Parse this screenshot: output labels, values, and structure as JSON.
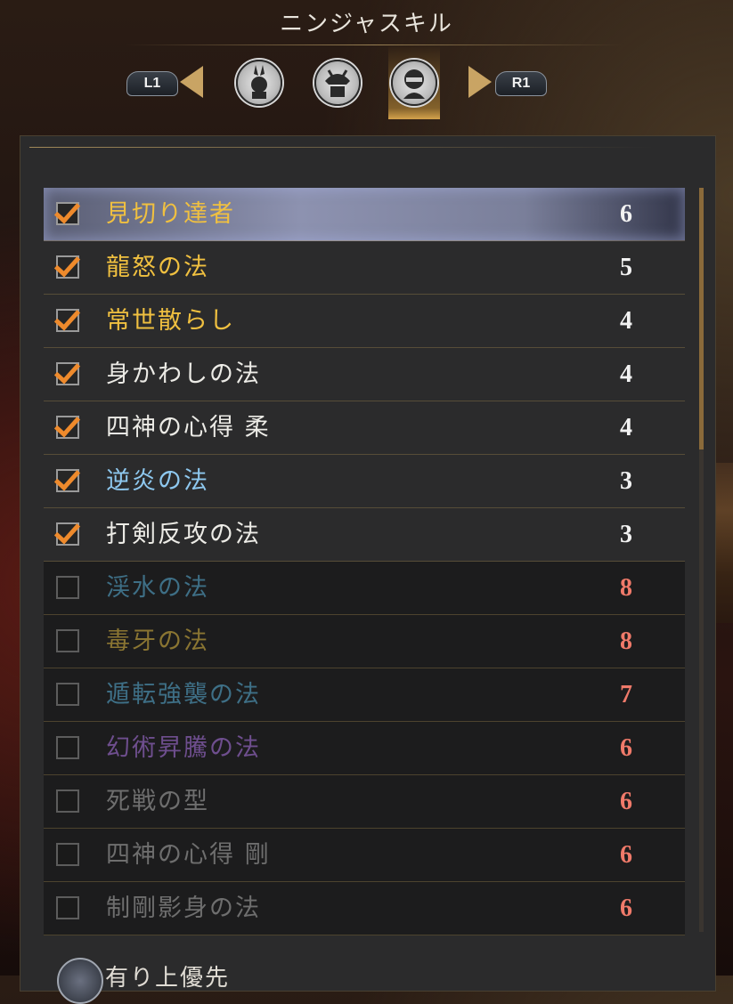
{
  "header": {
    "title": "ニンジャスキル"
  },
  "tabs": {
    "left_button": "L1",
    "right_button": "R1",
    "items": [
      {
        "icon": "ninja-rabbit-icon",
        "active": false
      },
      {
        "icon": "samurai-helmet-icon",
        "active": false
      },
      {
        "icon": "ninja-mask-icon",
        "active": true
      }
    ]
  },
  "skills": [
    {
      "name": "見切り達者",
      "cost": "6",
      "checked": true,
      "name_color": "#f0c040",
      "cost_color": "#f2f2f2",
      "selected": true
    },
    {
      "name": "龍怒の法",
      "cost": "5",
      "checked": true,
      "name_color": "#f0c040",
      "cost_color": "#f2f2f2"
    },
    {
      "name": "常世散らし",
      "cost": "4",
      "checked": true,
      "name_color": "#f0c040",
      "cost_color": "#f2f2f2"
    },
    {
      "name": "身かわしの法",
      "cost": "4",
      "checked": true,
      "name_color": "#ecebe6",
      "cost_color": "#f2f2f2"
    },
    {
      "name": "四神の心得 柔",
      "cost": "4",
      "checked": true,
      "name_color": "#ecebe6",
      "cost_color": "#f2f2f2"
    },
    {
      "name": "逆炎の法",
      "cost": "3",
      "checked": true,
      "name_color": "#8ec8ef",
      "cost_color": "#f2f2f2"
    },
    {
      "name": "打剣反攻の法",
      "cost": "3",
      "checked": true,
      "name_color": "#ecebe6",
      "cost_color": "#f2f2f2"
    },
    {
      "name": "渓水の法",
      "cost": "8",
      "checked": false,
      "name_color": "#3e6f86",
      "cost_color": "#f07a6a"
    },
    {
      "name": "毒牙の法",
      "cost": "8",
      "checked": false,
      "name_color": "#8a7532",
      "cost_color": "#f07a6a"
    },
    {
      "name": "遁転強襲の法",
      "cost": "7",
      "checked": false,
      "name_color": "#3e6f86",
      "cost_color": "#f07a6a"
    },
    {
      "name": "幻術昇騰の法",
      "cost": "6",
      "checked": false,
      "name_color": "#6e4e8e",
      "cost_color": "#f07a6a"
    },
    {
      "name": "死戦の型",
      "cost": "6",
      "checked": false,
      "name_color": "#6e6e6e",
      "cost_color": "#f07a6a"
    },
    {
      "name": "四神の心得 剛",
      "cost": "6",
      "checked": false,
      "name_color": "#6e6e6e",
      "cost_color": "#f07a6a"
    },
    {
      "name": "制剛影身の法",
      "cost": "6",
      "checked": false,
      "name_color": "#6e6e6e",
      "cost_color": "#f07a6a"
    }
  ],
  "footer": {
    "text": "有り上優先"
  }
}
